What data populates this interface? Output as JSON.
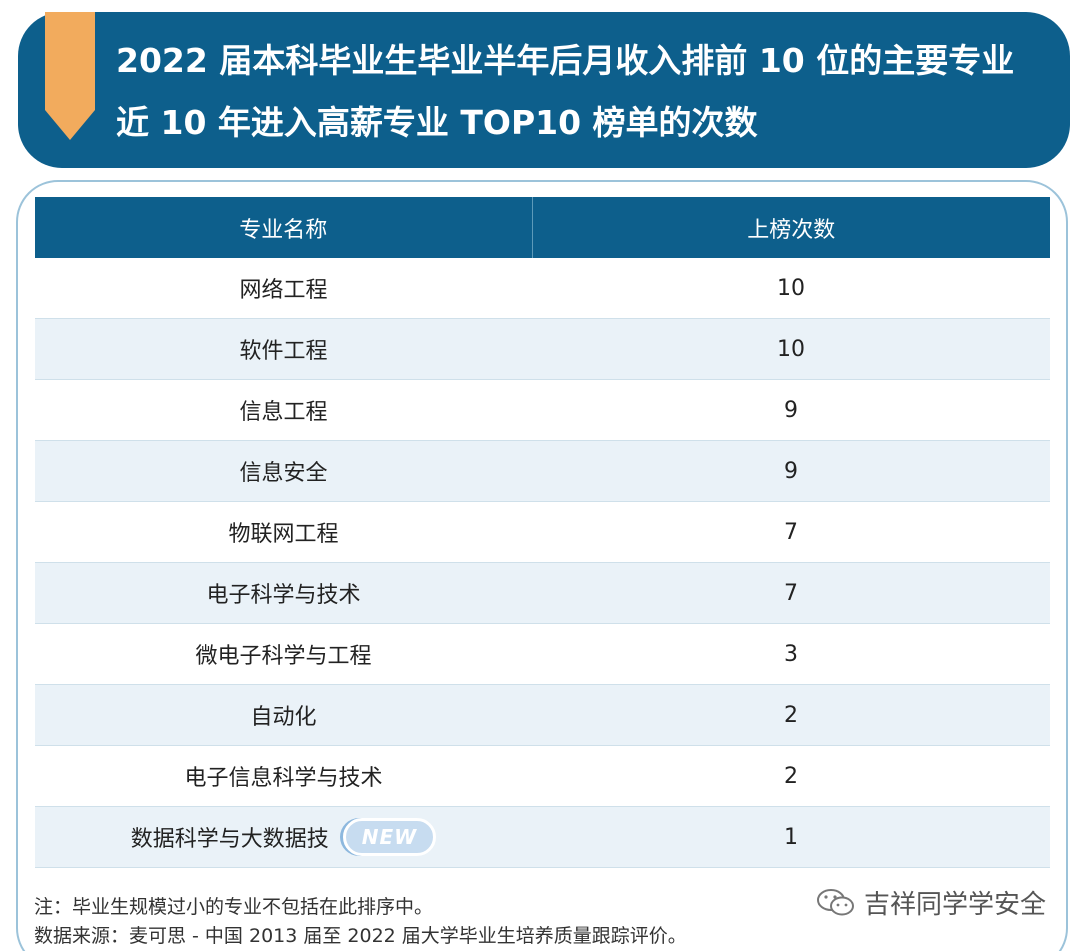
{
  "header": {
    "title_line1": "2022 届本科毕业生毕业半年后月收入排前 10 位的主要专业",
    "title_line2": "近 10 年进入高薪专业 TOP10 榜单的次数",
    "accent_color": "#0d5f8c",
    "ribbon_color": "#f2ab5d"
  },
  "table": {
    "columns": [
      "专业名称",
      "上榜次数"
    ],
    "rows": [
      {
        "name": "网络工程",
        "count": "10"
      },
      {
        "name": "软件工程",
        "count": "10"
      },
      {
        "name": "信息工程",
        "count": "9"
      },
      {
        "name": "信息安全",
        "count": "9"
      },
      {
        "name": "物联网工程",
        "count": "7"
      },
      {
        "name": "电子科学与技术",
        "count": "7"
      },
      {
        "name": "微电子科学与工程",
        "count": "3"
      },
      {
        "name": "自动化",
        "count": "2"
      },
      {
        "name": "电子信息科学与技术",
        "count": "2"
      },
      {
        "name": "数据科学与大数据技",
        "count": "1",
        "badge": "NEW"
      }
    ]
  },
  "notes": {
    "note": "注：毕业生规模过小的专业不包括在此排序中。",
    "source": "数据来源：麦可思 - 中国 2013 届至 2022 届大学毕业生培养质量跟踪评价。"
  },
  "watermark": {
    "text": "吉祥同学学安全",
    "icon": "wechat-icon"
  }
}
